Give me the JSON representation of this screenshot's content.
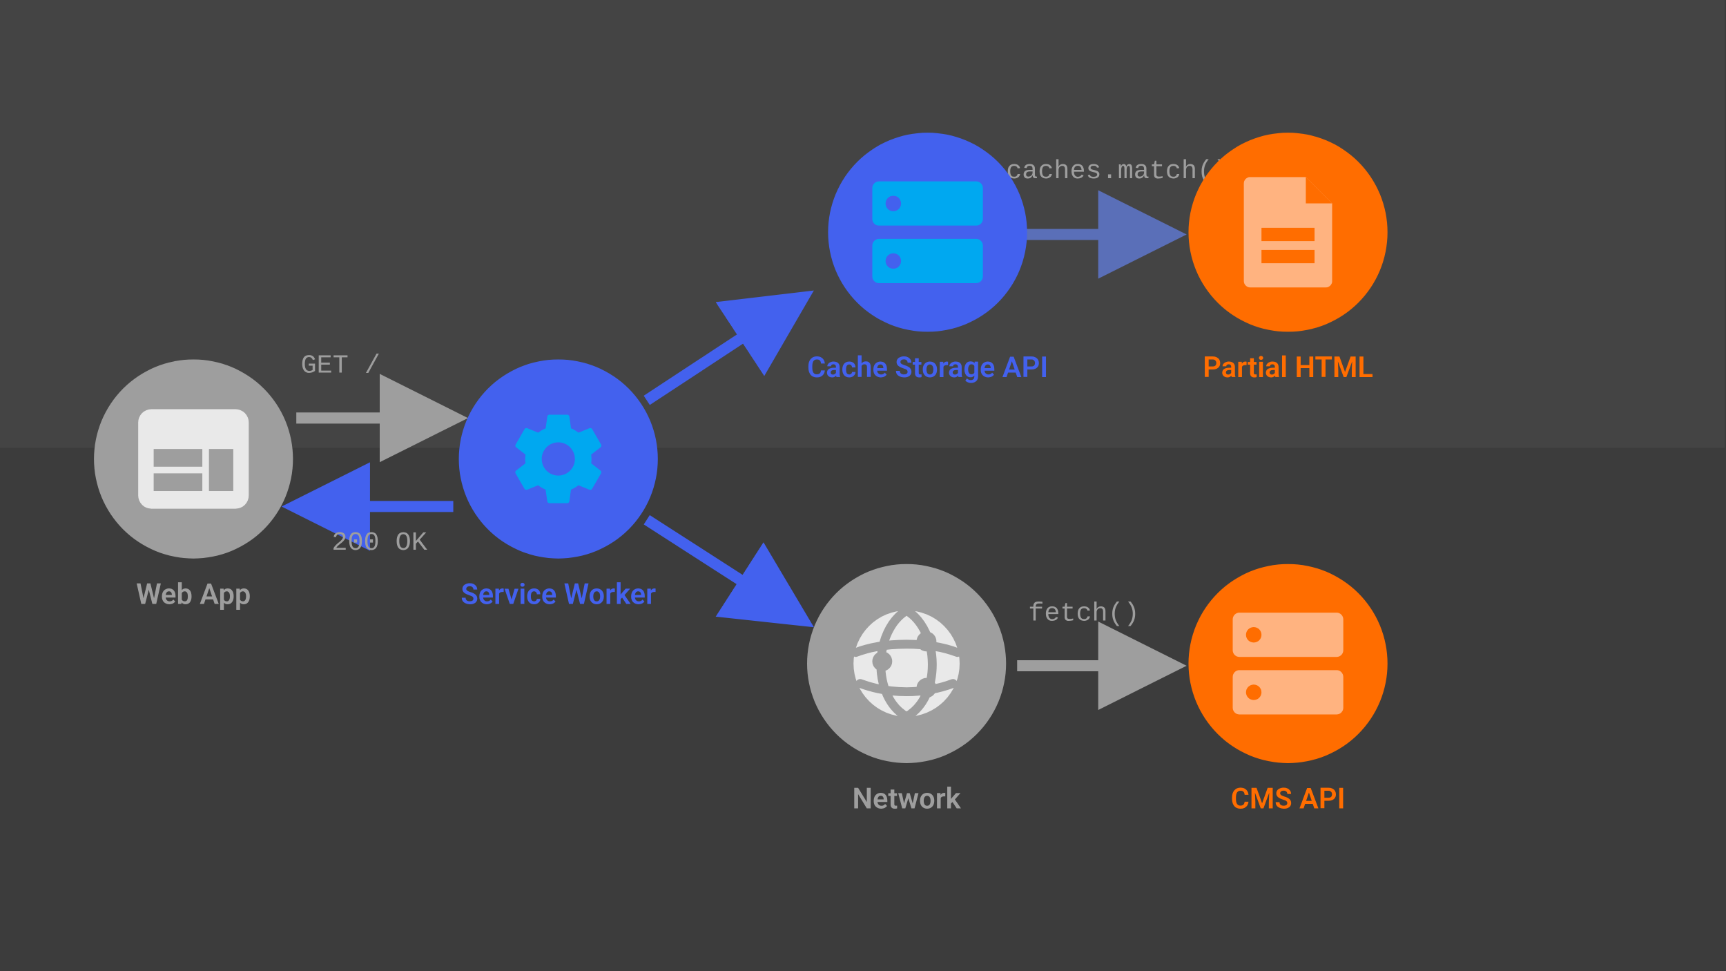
{
  "nodes": {
    "web_app": {
      "label": "Web App"
    },
    "service_worker": {
      "label": "Service Worker"
    },
    "cache_storage": {
      "label": "Cache Storage API"
    },
    "partial_html": {
      "label": "Partial HTML"
    },
    "network": {
      "label": "Network"
    },
    "cms_api": {
      "label": "CMS API"
    }
  },
  "edges": {
    "get": "GET /",
    "ok": "200 OK",
    "caches_match": "caches.match()",
    "fetch": "fetch()"
  },
  "colors": {
    "gray": "#9e9e9e",
    "blue": "#4361ee",
    "orange": "#ff6d00",
    "bg_top": "#444444",
    "bg_bottom": "#3c3c3c"
  }
}
